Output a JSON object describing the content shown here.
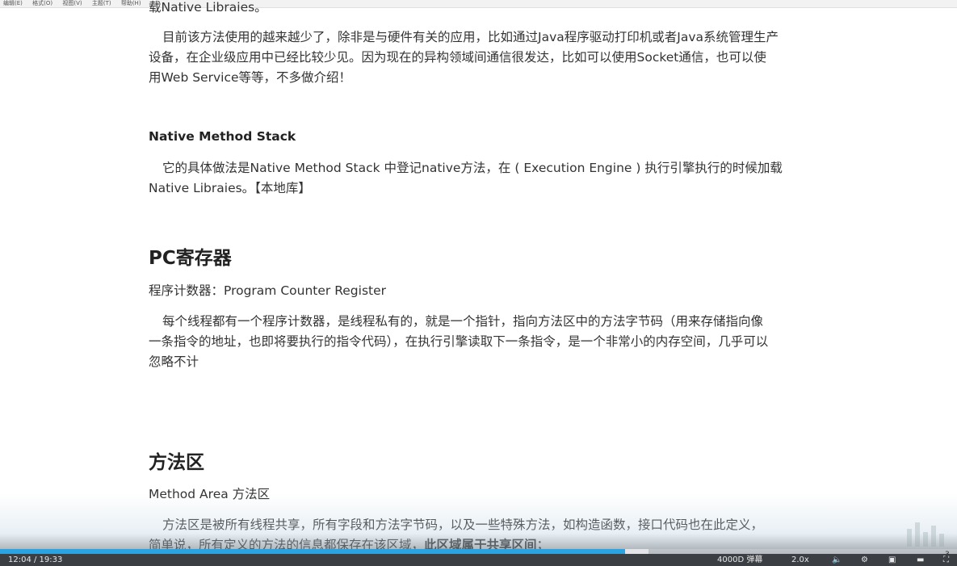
{
  "menubar": {
    "items": [
      "编辑(E)",
      "格式(O)",
      "视图(V)",
      "主题(T)",
      "帮助(H)"
    ]
  },
  "document": {
    "top_fragment": "载Native Libraies。",
    "para1": [
      "目前该方法使用的越来越少了，除非是与硬件有关的应用，比如通过Java程序驱动打印机或者Java系统管理生产",
      "设备，在企业级应用中已经比较少见。因为现在的异构领域间通信很发达，比如可以使用Socket通信，也可以使",
      "用Web Service等等，不多做介绍！"
    ],
    "heading_nms": "Native Method Stack",
    "para_nms": [
      "它的具体做法是Native Method Stack 中登记native方法，在 ( Execution Engine ) 执行引擎执行的时候加载",
      "Native Libraies。【本地库】"
    ],
    "heading_pc": "PC寄存器",
    "pc_subtitle": "程序计数器：Program Counter Register",
    "para_pc": [
      "每个线程都有一个程序计数器，是线程私有的，就是一个指针，指向方法区中的方法字节码（用来存储指向像",
      "一条指令的地址，也即将要执行的指令代码），在执行引擎读取下一条指令，是一个非常小的内存空间，几乎可以",
      "忽略不计"
    ],
    "heading_method": "方法区",
    "method_subtitle": "Method Area 方法区",
    "para_method_line1": "方法区是被所有线程共享，所有字段和方法字节码，以及一些特殊方法，如构造函数，接口代码也在此定义，",
    "para_method_line2_normal": "简单说，所有定义的方法的信息都保存在该区域，",
    "para_method_line2_bold": "此区域属于共享区间",
    "para_method_line2_end": "；"
  },
  "player": {
    "time": "12:04 / 19:33",
    "progress_fraction": 0.653,
    "buffered_fraction": 0.678,
    "danmaku_label": "4000D 弹幕",
    "speed_label": "2.0x",
    "accent_color": "#2aa3e0",
    "page_marker": "3"
  }
}
